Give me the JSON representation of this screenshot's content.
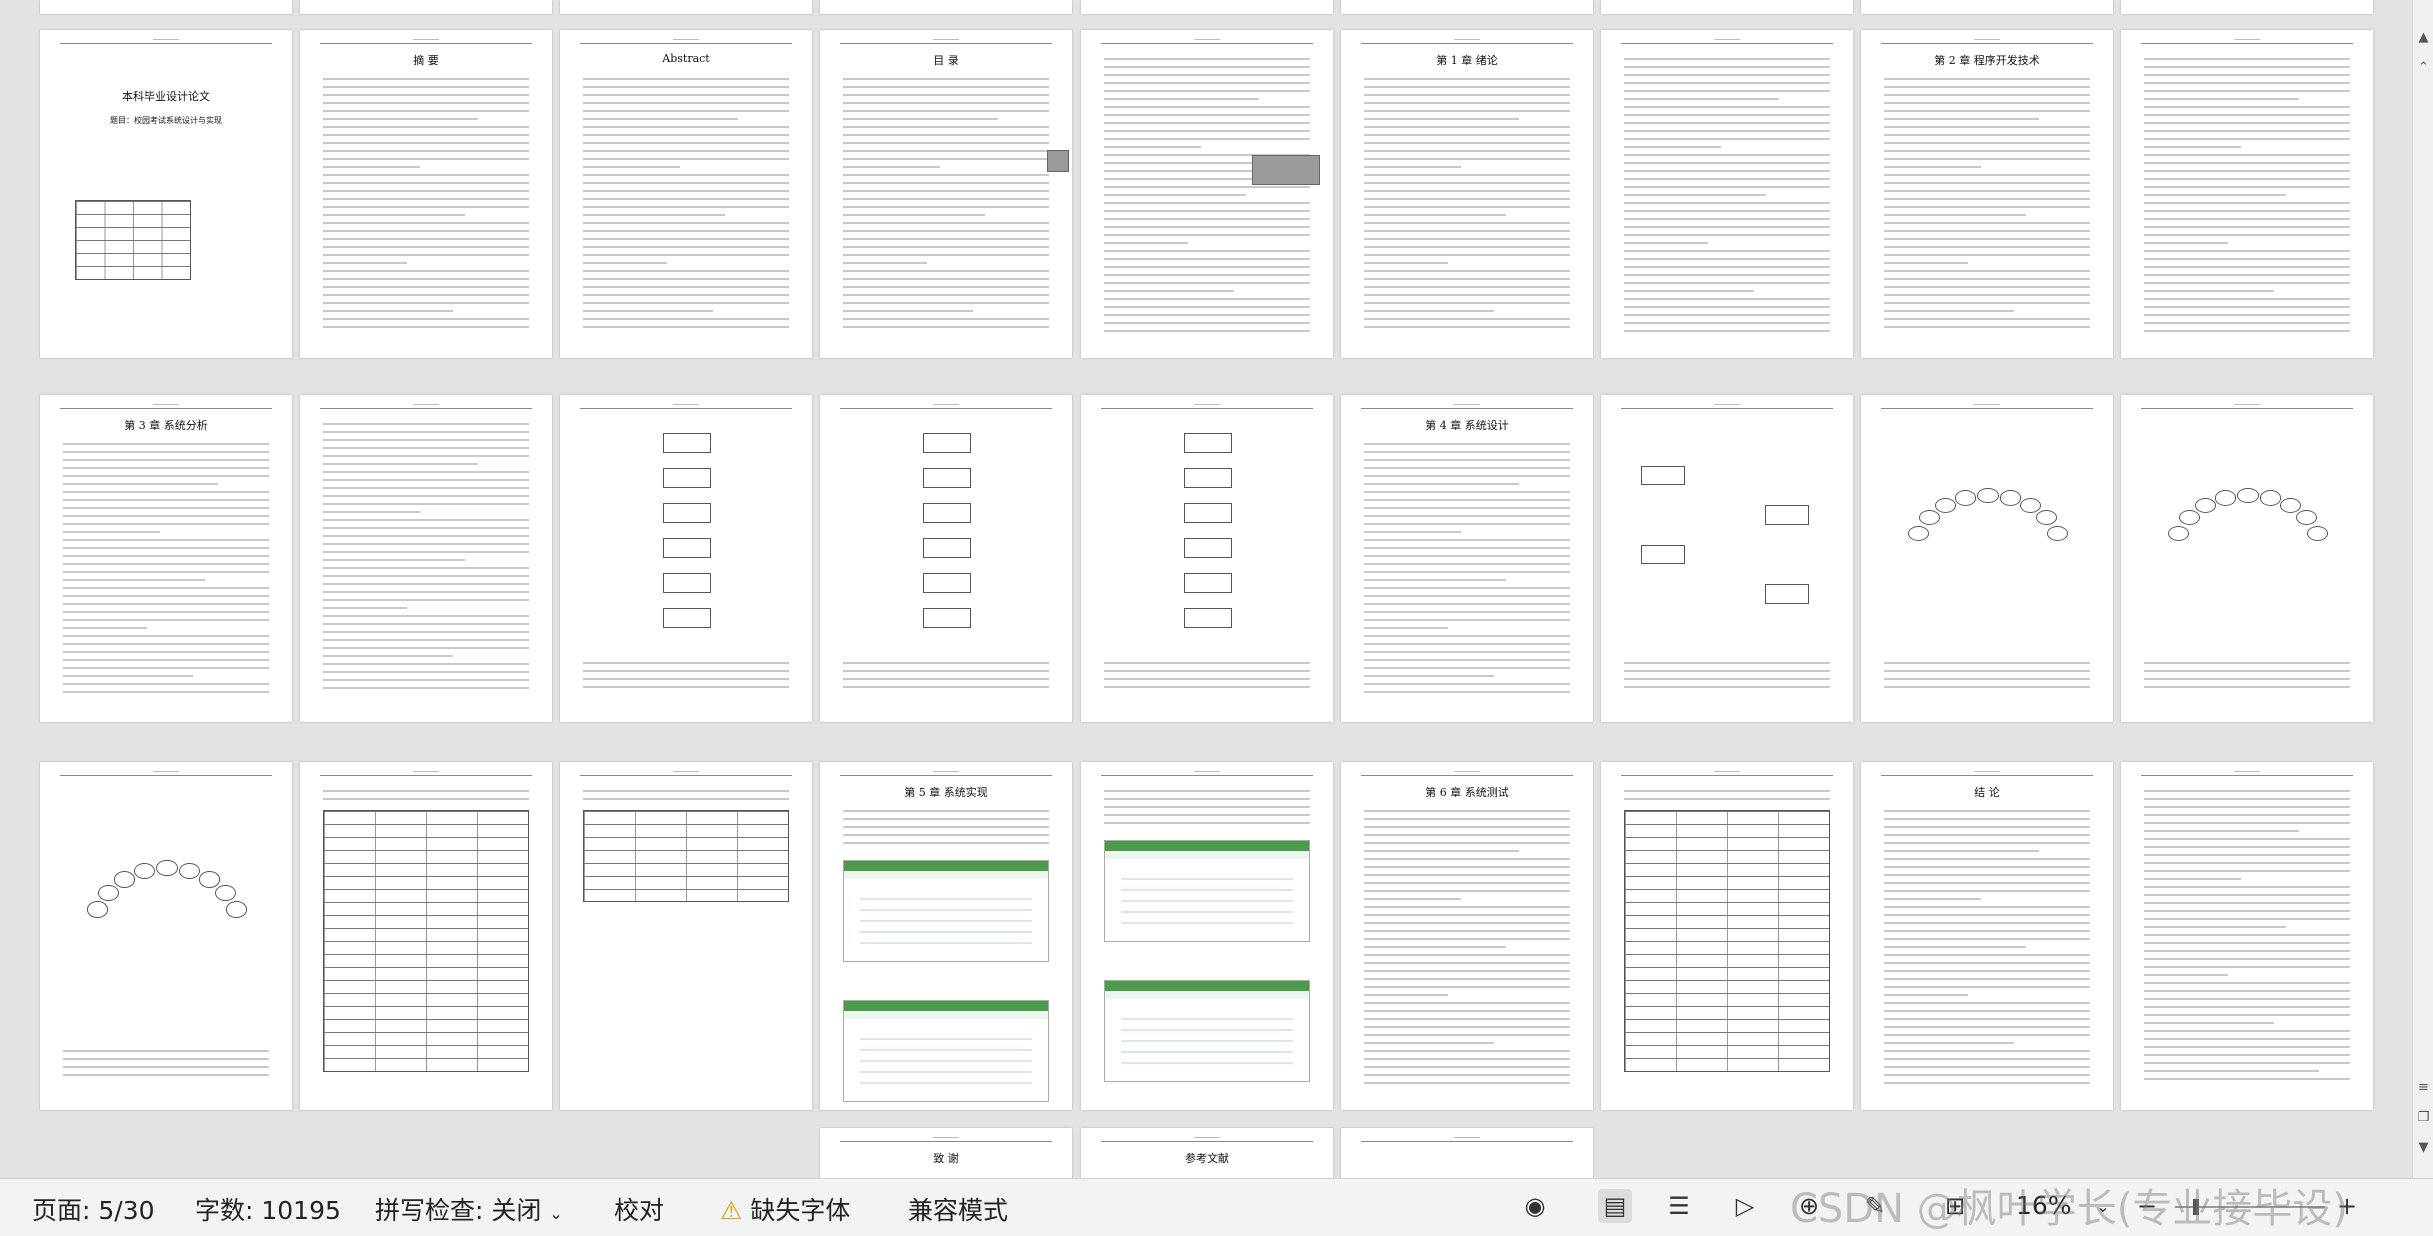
{
  "document": {
    "cover_title": "本科毕业设计论文",
    "cover_subtitle": "题目：校园考试系统设计与实现",
    "abstract_cn_title": "摘 要",
    "abstract_en_title": "Abstract",
    "toc_title": "目 录",
    "ch1_title": "第 1 章  绪论",
    "ch2_title": "第 2 章  程序开发技术",
    "ch3_title": "第 3 章  系统分析",
    "ch4_title": "第 4 章  系统设计",
    "ch5_title": "第 5 章  系统实现",
    "ch6_title": "第 6 章  系统测试",
    "conclusion_title": "结 论",
    "ack_title": "致 谢",
    "ref_title": "参考文献"
  },
  "statusbar": {
    "page": "页面: 5/30",
    "words": "字数: 10195",
    "spellcheck": "拼写检查: 关闭",
    "proofread": "校对",
    "missing_font": "缺失字体",
    "compat_mode": "兼容模式",
    "zoom": "16%",
    "icons": [
      "eye-icon",
      "page-view-icon",
      "outline-icon",
      "play-icon",
      "web-icon",
      "pen-icon",
      "crop-icon"
    ]
  },
  "watermark": "CSDN @枫叶学长(专业接毕设)"
}
